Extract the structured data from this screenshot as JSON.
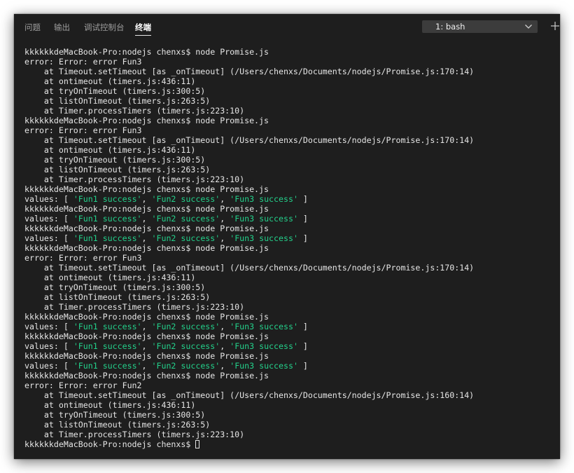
{
  "tabs": [
    {
      "label": "问题",
      "active": false
    },
    {
      "label": "输出",
      "active": false
    },
    {
      "label": "调试控制台",
      "active": false
    },
    {
      "label": "终端",
      "active": true
    }
  ],
  "terminal_select": {
    "value": "1: bash",
    "icon": "chevron-down-icon"
  },
  "new_terminal": {
    "icon": "plus-icon"
  },
  "colors": {
    "background": "#1e1e1e",
    "text": "#e6e6e6",
    "string": "#23d18b",
    "tab_inactive": "#9d9d9d"
  },
  "prompt": "kkkkkkdeMacBook-Pro:nodejs chenxs$",
  "lines": [
    {
      "segments": [
        {
          "text": "kkkkkkdeMacBook-Pro:nodejs chenxs$ node Promise.js"
        }
      ]
    },
    {
      "segments": [
        {
          "text": "error: Error: error Fun3"
        }
      ]
    },
    {
      "segments": [
        {
          "text": "    at Timeout.setTimeout [as _onTimeout] (/Users/chenxs/Documents/nodejs/Promise.js:170:14)"
        }
      ]
    },
    {
      "segments": [
        {
          "text": "    at ontimeout (timers.js:436:11)"
        }
      ]
    },
    {
      "segments": [
        {
          "text": "    at tryOnTimeout (timers.js:300:5)"
        }
      ]
    },
    {
      "segments": [
        {
          "text": "    at listOnTimeout (timers.js:263:5)"
        }
      ]
    },
    {
      "segments": [
        {
          "text": "    at Timer.processTimers (timers.js:223:10)"
        }
      ]
    },
    {
      "segments": [
        {
          "text": "kkkkkkdeMacBook-Pro:nodejs chenxs$ node Promise.js"
        }
      ]
    },
    {
      "segments": [
        {
          "text": "error: Error: error Fun3"
        }
      ]
    },
    {
      "segments": [
        {
          "text": "    at Timeout.setTimeout [as _onTimeout] (/Users/chenxs/Documents/nodejs/Promise.js:170:14)"
        }
      ]
    },
    {
      "segments": [
        {
          "text": "    at ontimeout (timers.js:436:11)"
        }
      ]
    },
    {
      "segments": [
        {
          "text": "    at tryOnTimeout (timers.js:300:5)"
        }
      ]
    },
    {
      "segments": [
        {
          "text": "    at listOnTimeout (timers.js:263:5)"
        }
      ]
    },
    {
      "segments": [
        {
          "text": "    at Timer.processTimers (timers.js:223:10)"
        }
      ]
    },
    {
      "segments": [
        {
          "text": "kkkkkkdeMacBook-Pro:nodejs chenxs$ node Promise.js"
        }
      ]
    },
    {
      "segments": [
        {
          "text": "values: [ "
        },
        {
          "text": "'Fun1 success'",
          "cls": "str"
        },
        {
          "text": ", "
        },
        {
          "text": "'Fun2 success'",
          "cls": "str"
        },
        {
          "text": ", "
        },
        {
          "text": "'Fun3 success'",
          "cls": "str"
        },
        {
          "text": " ]"
        }
      ]
    },
    {
      "segments": [
        {
          "text": "kkkkkkdeMacBook-Pro:nodejs chenxs$ node Promise.js"
        }
      ]
    },
    {
      "segments": [
        {
          "text": "values: [ "
        },
        {
          "text": "'Fun1 success'",
          "cls": "str"
        },
        {
          "text": ", "
        },
        {
          "text": "'Fun2 success'",
          "cls": "str"
        },
        {
          "text": ", "
        },
        {
          "text": "'Fun3 success'",
          "cls": "str"
        },
        {
          "text": " ]"
        }
      ]
    },
    {
      "segments": [
        {
          "text": "kkkkkkdeMacBook-Pro:nodejs chenxs$ node Promise.js"
        }
      ]
    },
    {
      "segments": [
        {
          "text": "values: [ "
        },
        {
          "text": "'Fun1 success'",
          "cls": "str"
        },
        {
          "text": ", "
        },
        {
          "text": "'Fun2 success'",
          "cls": "str"
        },
        {
          "text": ", "
        },
        {
          "text": "'Fun3 success'",
          "cls": "str"
        },
        {
          "text": " ]"
        }
      ]
    },
    {
      "segments": [
        {
          "text": "kkkkkkdeMacBook-Pro:nodejs chenxs$ node Promise.js"
        }
      ]
    },
    {
      "segments": [
        {
          "text": "error: Error: error Fun3"
        }
      ]
    },
    {
      "segments": [
        {
          "text": "    at Timeout.setTimeout [as _onTimeout] (/Users/chenxs/Documents/nodejs/Promise.js:170:14)"
        }
      ]
    },
    {
      "segments": [
        {
          "text": "    at ontimeout (timers.js:436:11)"
        }
      ]
    },
    {
      "segments": [
        {
          "text": "    at tryOnTimeout (timers.js:300:5)"
        }
      ]
    },
    {
      "segments": [
        {
          "text": "    at listOnTimeout (timers.js:263:5)"
        }
      ]
    },
    {
      "segments": [
        {
          "text": "    at Timer.processTimers (timers.js:223:10)"
        }
      ]
    },
    {
      "segments": [
        {
          "text": "kkkkkkdeMacBook-Pro:nodejs chenxs$ node Promise.js"
        }
      ]
    },
    {
      "segments": [
        {
          "text": "values: [ "
        },
        {
          "text": "'Fun1 success'",
          "cls": "str"
        },
        {
          "text": ", "
        },
        {
          "text": "'Fun2 success'",
          "cls": "str"
        },
        {
          "text": ", "
        },
        {
          "text": "'Fun3 success'",
          "cls": "str"
        },
        {
          "text": " ]"
        }
      ]
    },
    {
      "segments": [
        {
          "text": "kkkkkkdeMacBook-Pro:nodejs chenxs$ node Promise.js"
        }
      ]
    },
    {
      "segments": [
        {
          "text": "values: [ "
        },
        {
          "text": "'Fun1 success'",
          "cls": "str"
        },
        {
          "text": ", "
        },
        {
          "text": "'Fun2 success'",
          "cls": "str"
        },
        {
          "text": ", "
        },
        {
          "text": "'Fun3 success'",
          "cls": "str"
        },
        {
          "text": " ]"
        }
      ]
    },
    {
      "segments": [
        {
          "text": "kkkkkkdeMacBook-Pro:nodejs chenxs$ node Promise.js"
        }
      ]
    },
    {
      "segments": [
        {
          "text": "values: [ "
        },
        {
          "text": "'Fun1 success'",
          "cls": "str"
        },
        {
          "text": ", "
        },
        {
          "text": "'Fun2 success'",
          "cls": "str"
        },
        {
          "text": ", "
        },
        {
          "text": "'Fun3 success'",
          "cls": "str"
        },
        {
          "text": " ]"
        }
      ]
    },
    {
      "segments": [
        {
          "text": "kkkkkkdeMacBook-Pro:nodejs chenxs$ node Promise.js"
        }
      ]
    },
    {
      "segments": [
        {
          "text": "error: Error: error Fun2"
        }
      ]
    },
    {
      "segments": [
        {
          "text": "    at Timeout.setTimeout [as _onTimeout] (/Users/chenxs/Documents/nodejs/Promise.js:160:14)"
        }
      ]
    },
    {
      "segments": [
        {
          "text": "    at ontimeout (timers.js:436:11)"
        }
      ]
    },
    {
      "segments": [
        {
          "text": "    at tryOnTimeout (timers.js:300:5)"
        }
      ]
    },
    {
      "segments": [
        {
          "text": "    at listOnTimeout (timers.js:263:5)"
        }
      ]
    },
    {
      "segments": [
        {
          "text": "    at Timer.processTimers (timers.js:223:10)"
        }
      ]
    }
  ]
}
